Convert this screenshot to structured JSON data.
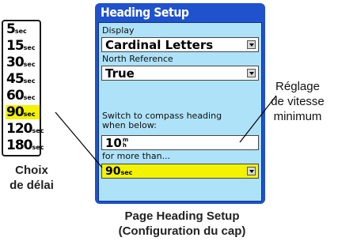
{
  "delay_list": {
    "items": [
      {
        "num": "5",
        "unit": "sec",
        "selected": false
      },
      {
        "num": "15",
        "unit": "sec",
        "selected": false
      },
      {
        "num": "30",
        "unit": "sec",
        "selected": false
      },
      {
        "num": "45",
        "unit": "sec",
        "selected": false
      },
      {
        "num": "60",
        "unit": "sec",
        "selected": false
      },
      {
        "num": "90",
        "unit": "sec",
        "selected": true
      },
      {
        "num": "120",
        "unit": "sec",
        "selected": false
      },
      {
        "num": "180",
        "unit": "sec",
        "selected": false
      }
    ],
    "caption_line1": "Choix",
    "caption_line2": "de délai"
  },
  "screen": {
    "title": "Heading Setup",
    "display_label": "Display",
    "display_value": "Cardinal Letters",
    "north_label": "North Reference",
    "north_value": "True",
    "switch_label_line1": "Switch to compass heading",
    "switch_label_line2": "when below:",
    "speed_value": "10",
    "speed_unit_top": "m",
    "speed_unit_bottom": "h",
    "more_label": "for more than...",
    "delay_num": "90",
    "delay_unit": "sec"
  },
  "callout": {
    "line1": "Réglage",
    "line2": "de vitesse",
    "line3": "minimum"
  },
  "caption": {
    "line1": "Page Heading Setup",
    "line2": "(Configuration du cap)"
  },
  "colors": {
    "screen_blue": "#1f52cc",
    "panel_light_blue": "#aee2f8",
    "highlight_yellow": "#f3f300"
  }
}
